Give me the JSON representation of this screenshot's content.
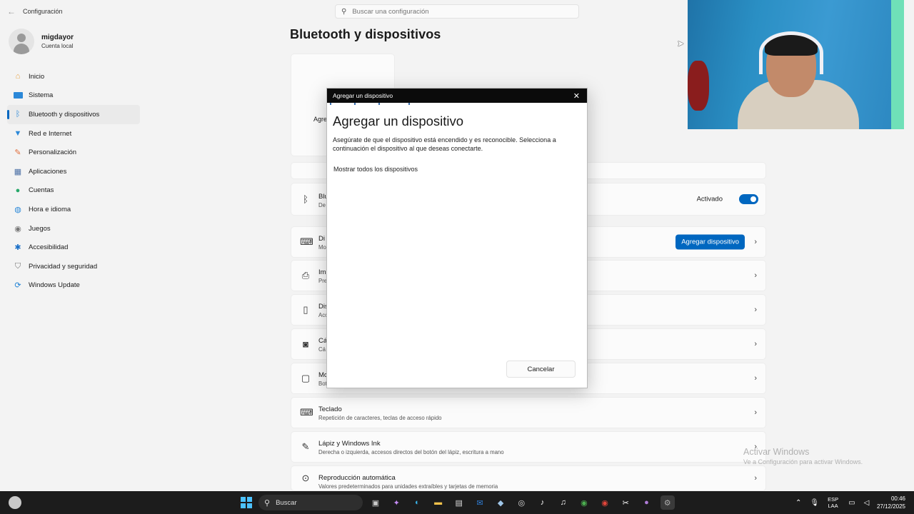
{
  "window": {
    "title": "Configuración"
  },
  "search": {
    "placeholder": "Buscar una configuración"
  },
  "profile": {
    "name": "migdayor",
    "account": "Cuenta local"
  },
  "sidebar": {
    "items": [
      {
        "label": "Inicio",
        "icon": "home-icon",
        "color": "#e8a040"
      },
      {
        "label": "Sistema",
        "icon": "monitor-icon",
        "color": "#2b88d8"
      },
      {
        "label": "Bluetooth y dispositivos",
        "icon": "bluetooth-icon",
        "color": "#2b88d8",
        "active": true
      },
      {
        "label": "Red e Internet",
        "icon": "wifi-icon",
        "color": "#2b88d8"
      },
      {
        "label": "Personalización",
        "icon": "brush-icon",
        "color": "#e06c3a"
      },
      {
        "label": "Aplicaciones",
        "icon": "apps-icon",
        "color": "#4a6fa5"
      },
      {
        "label": "Cuentas",
        "icon": "person-icon",
        "color": "#27a86a"
      },
      {
        "label": "Hora e idioma",
        "icon": "globe-icon",
        "color": "#2b88d8"
      },
      {
        "label": "Juegos",
        "icon": "gamepad-icon",
        "color": "#777777"
      },
      {
        "label": "Accesibilidad",
        "icon": "accessibility-icon",
        "color": "#1a6fc7"
      },
      {
        "label": "Privacidad y seguridad",
        "icon": "shield-icon",
        "color": "#777777"
      },
      {
        "label": "Windows Update",
        "icon": "update-icon",
        "color": "#1a7fd4"
      }
    ]
  },
  "main": {
    "title": "Bluetooth y dispositivos",
    "hero_label": "Agre",
    "bluetooth_row": {
      "title": "Blu",
      "subtitle": "De",
      "toggle_label": "Activado"
    },
    "devices_row": {
      "title": "Di",
      "subtitle": "Mo",
      "button": "Agregar dispositivo"
    },
    "rows": [
      {
        "title": "Im",
        "subtitle": "Pre",
        "icon": "printer-icon"
      },
      {
        "title": "Dis",
        "subtitle": "Acc",
        "icon": "phone-icon"
      },
      {
        "title": "Cá",
        "subtitle": "Cá",
        "icon": "camera-icon"
      },
      {
        "title": "Mo",
        "subtitle": "Bot",
        "icon": "mouse-icon"
      },
      {
        "title": "Teclado",
        "subtitle": "Repetición de caracteres, teclas de acceso rápido",
        "icon": "keyboard-icon"
      },
      {
        "title": "Lápiz y Windows Ink",
        "subtitle": "Derecha o izquierda, accesos directos del botón del lápiz, escritura a mano",
        "icon": "pen-icon"
      },
      {
        "title": "Reproducción automática",
        "subtitle": "Valores predeterminados para unidades extraíbles y tarjetas de memoria",
        "icon": "autoplay-icon"
      }
    ]
  },
  "dialog": {
    "bar_title": "Agregar un dispositivo",
    "heading": "Agregar un dispositivo",
    "description": "Asegúrate de que el dispositivo está encendido y es reconocible. Selecciona a continuación el dispositivo al que deseas conectarte.",
    "show_all": "Mostrar todos los dispositivos",
    "cancel": "Cancelar"
  },
  "watermark": {
    "line1": "Activar Windows",
    "line2": "Ve a Configuración para activar Windows."
  },
  "taskbar": {
    "search_label": "Buscar",
    "language": "ESP",
    "layout": "LAA",
    "time": "00:46",
    "date": "27/12/2025"
  },
  "colors": {
    "accent": "#0067c0",
    "taskbar": "#1c1c1c",
    "dialog_bar": "#0b0b0b"
  }
}
